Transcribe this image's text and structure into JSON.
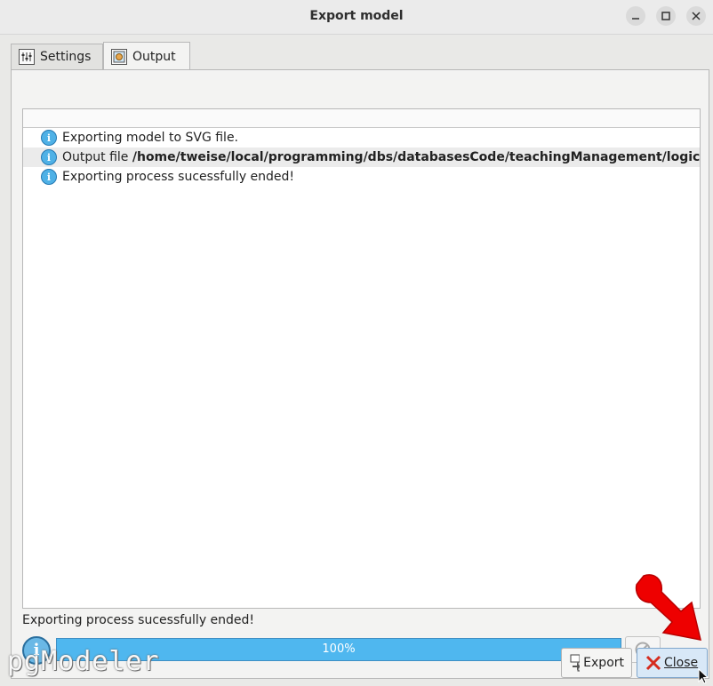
{
  "window": {
    "title": "Export model",
    "controls": [
      "minimize",
      "maximize",
      "close"
    ]
  },
  "tabs": [
    {
      "label": "Settings",
      "icon": "settings-icon",
      "active": false
    },
    {
      "label": "Output",
      "icon": "output-icon",
      "active": true
    }
  ],
  "log": {
    "entries": [
      {
        "icon": "info-icon",
        "prefix": "Exporting model to SVG file.",
        "bold": ""
      },
      {
        "icon": "info-icon",
        "prefix": "Output file ",
        "bold": "/home/tweise/local/programming/dbs/databasesCode/teachingManagement/logical/stude"
      },
      {
        "icon": "info-icon",
        "prefix": "Exporting process sucessfully ended!",
        "bold": ""
      }
    ]
  },
  "status": {
    "message": "Exporting process sucessfully ended!",
    "progress_percent": 100,
    "progress_label": "100%"
  },
  "footer": {
    "logo": "pgModeler",
    "export_label": "Export",
    "close_label": "Close"
  },
  "colors": {
    "progress_fill": "#4fb7ef",
    "info_blue": "#4fb1e6",
    "annotation_arrow": "#ee0000"
  }
}
